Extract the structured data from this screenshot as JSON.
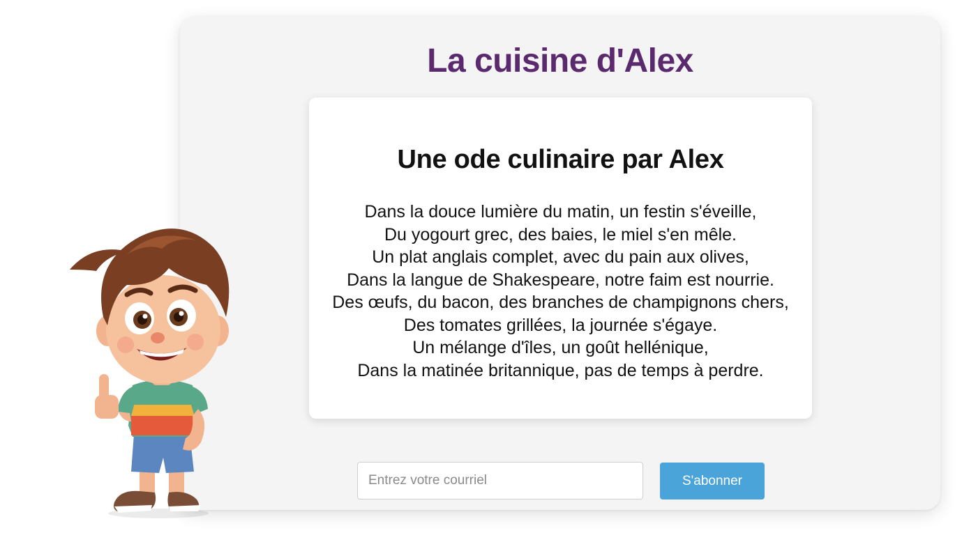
{
  "header": {
    "title": "La cuisine d'Alex"
  },
  "poem": {
    "title": "Une ode culinaire par Alex",
    "lines": [
      "Dans la douce lumière du matin, un festin s'éveille,",
      "Du yogourt grec, des baies, le miel s'en mêle.",
      "Un plat anglais complet, avec du pain aux olives,",
      "Dans la langue de Shakespeare, notre faim est nourrie.",
      "Des œufs, du bacon, des branches de champignons chers,",
      "Des tomates grillées, la journée s'égaye.",
      "Un mélange d'îles, un goût hellénique,",
      "Dans la matinée britannique, pas de temps à perdre."
    ]
  },
  "subscribe": {
    "placeholder": "Entrez votre courriel",
    "value": "",
    "button_label": "S'abonner"
  },
  "colors": {
    "title": "#5b2a6e",
    "button": "#4aa3d9",
    "panel_background": "#f4f4f5",
    "card_background": "#ffffff"
  },
  "illustration": {
    "icon": "cartoon-boy-thumbs-up"
  }
}
